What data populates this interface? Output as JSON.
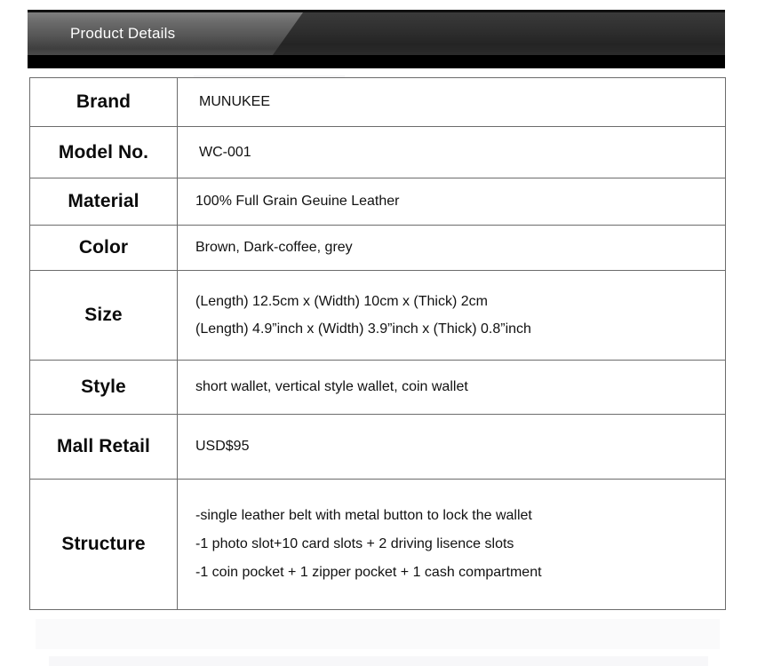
{
  "banner": {
    "title": "Product Details"
  },
  "table": {
    "rows": [
      {
        "label": "Brand",
        "lines": [
          "MUNUKEE"
        ]
      },
      {
        "label": "Model No.",
        "lines": [
          "WC-001"
        ]
      },
      {
        "label": "Material",
        "lines": [
          "100% Full Grain  Geuine Leather"
        ]
      },
      {
        "label": "Color",
        "lines": [
          "Brown, Dark-coffee, grey"
        ]
      },
      {
        "label": "Size",
        "lines": [
          "(Length) 12.5cm x (Width) 10cm x (Thick) 2cm",
          "(Length) 4.9”inch x (Width) 3.9”inch x (Thick) 0.8”inch"
        ]
      },
      {
        "label": "Style",
        "lines": [
          "short wallet, vertical style wallet, coin wallet"
        ]
      },
      {
        "label": "Mall Retail",
        "lines": [
          "USD$95"
        ]
      },
      {
        "label": "Structure",
        "lines": [
          "-single leather belt with metal button to lock the wallet",
          "-1 photo slot+10 card slots + 2 driving lisence slots",
          "-1 coin pocket + 1 zipper pocket + 1 cash compartment"
        ]
      }
    ]
  },
  "colors": {
    "banner_dark": "#2b2b2b",
    "banner_tab": "#6b6b6b",
    "banner_strip": "#000000",
    "table_border": "#6c6c6c",
    "text": "#111111",
    "page_background": "#ffffff"
  }
}
